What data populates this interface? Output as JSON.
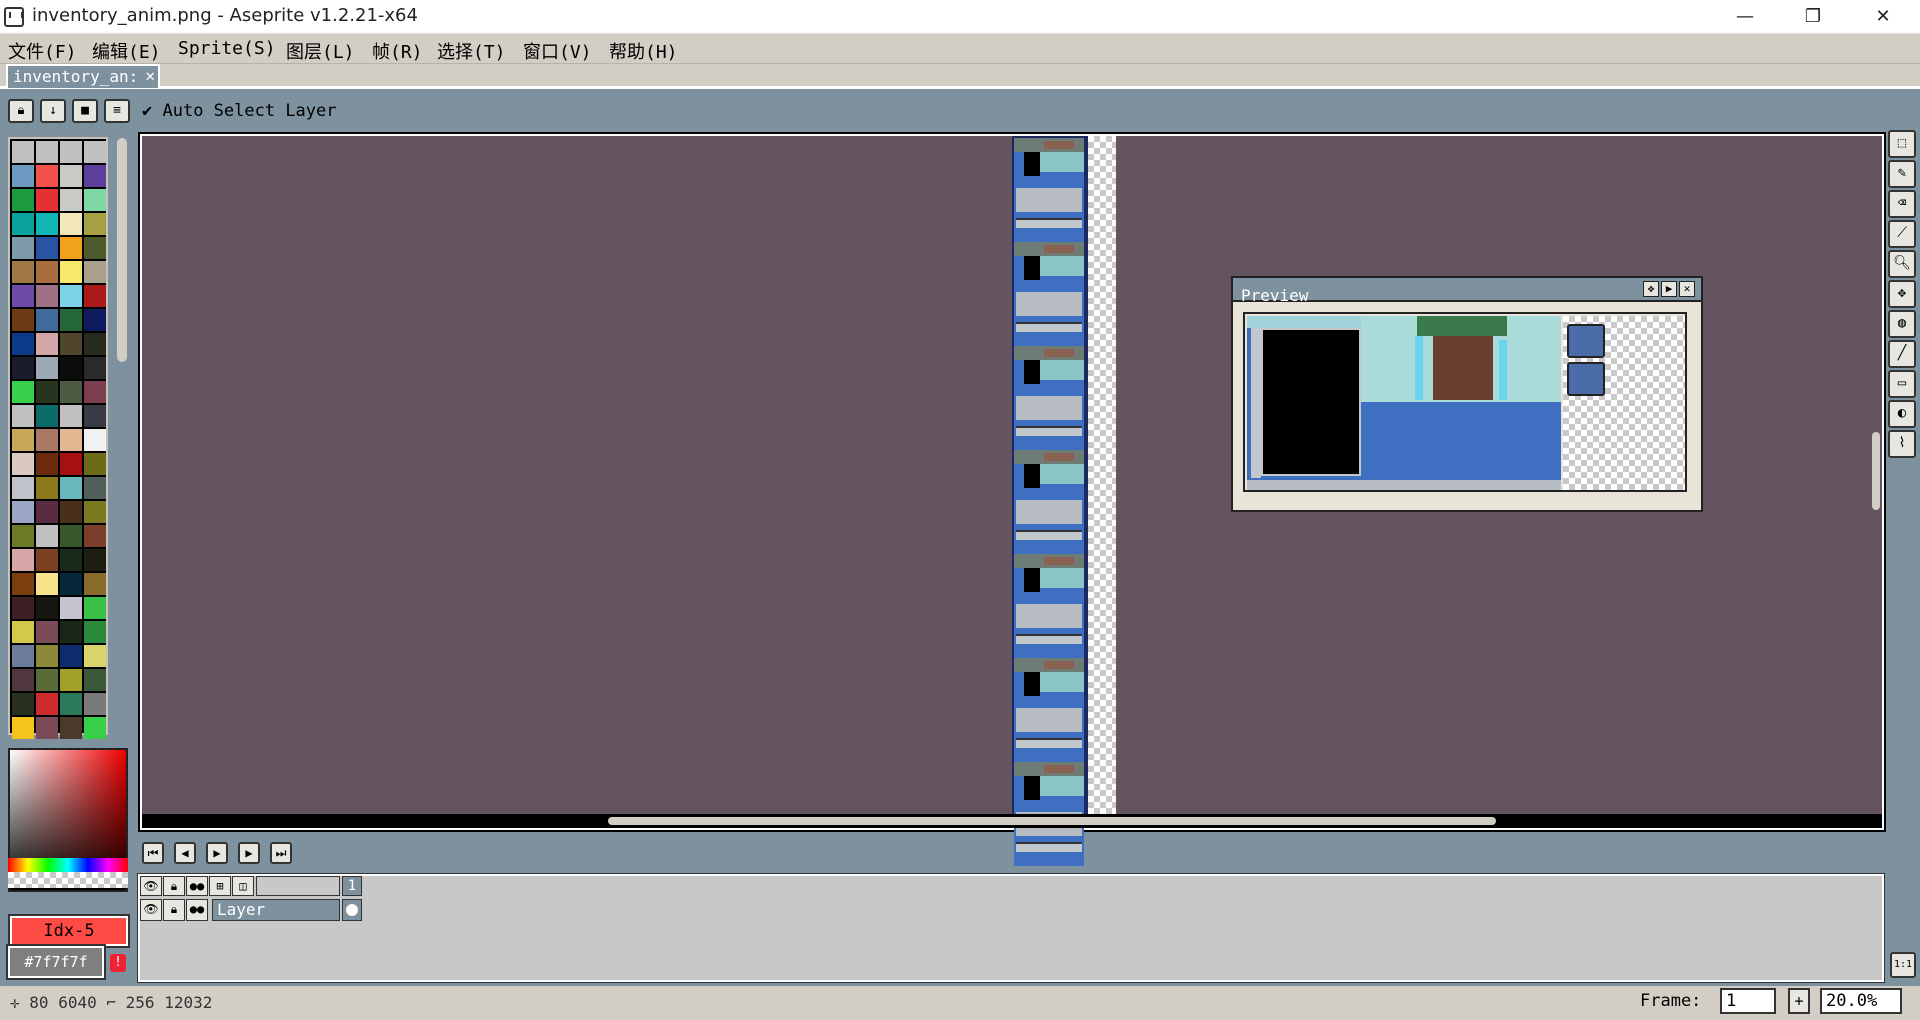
{
  "window": {
    "title": "inventory_anim.png - Aseprite v1.2.21-x64",
    "minimize": "—",
    "maximize": "❐",
    "close": "✕"
  },
  "menu": [
    "文件(F)",
    "编辑(E)",
    "Sprite(S)",
    "图层(L)",
    "帧(R)",
    "选择(T)",
    "窗口(V)",
    "帮助(H)"
  ],
  "tab": {
    "label": "inventory_an:",
    "close": "✕"
  },
  "context_bar": {
    "auto_select_label": "Auto Select Layer",
    "checkmark": "✔"
  },
  "preview": {
    "title": "Preview"
  },
  "color": {
    "index_label": "Idx-5",
    "hex_label": "#7f7f7f",
    "foreground": "#ff4b45",
    "background": "#7f7f7f",
    "warning_icon": "!"
  },
  "timeline": {
    "frame_number": "1",
    "layer_name": "Layer"
  },
  "status": {
    "pos_icon": "✛",
    "pos_x": "80",
    "pos_y": "6040",
    "size_icon": "⌐",
    "size_w": "256",
    "size_h": "12032",
    "frame_label": "Frame:",
    "frame_value": "1",
    "plus": "+",
    "zoom_value": "20.0%"
  },
  "tools": [
    "rectangular-marquee-icon",
    "pencil-icon",
    "eraser-icon",
    "eyedropper-icon",
    "zoom-icon",
    "move-icon",
    "paint-bucket-icon",
    "line-icon",
    "rectangle-icon",
    "blur-icon",
    "contour-icon"
  ],
  "palette_colors": [
    "#c0c0c0",
    "#c0c0c0",
    "#c0c0c0",
    "#c0c0c0",
    "#6d9ac0",
    "#f4504c",
    "#c9ccc5",
    "#5a3f9b",
    "#1e9b3c",
    "#e53131",
    "#c9ccc5",
    "#7dd8a3",
    "#0aa39d",
    "#12b6b4",
    "#f2e8ba",
    "#a4a043",
    "#7d9ba8",
    "#2a54a3",
    "#f2a11c",
    "#4d5a2b",
    "#a07845",
    "#aa6d3e",
    "#f6e96c",
    "#a8a08c",
    "#6d4aa8",
    "#a07086",
    "#7ed2e8",
    "#aa1a1a",
    "#6b3c13",
    "#3f6b9a",
    "#26673a",
    "#0e1a5b",
    "#0d3a89",
    "#d3a7a7",
    "#4f452a",
    "#252b1f",
    "#181c2b",
    "#9ca9b4",
    "#0a0d0a",
    "#2a2a2a",
    "#38d04a",
    "#27351f",
    "#4f5a43",
    "#7b3e4f",
    "#c0c0c0",
    "#0c6b66",
    "#c0c0c0",
    "#383b45",
    "#c9a75a",
    "#a87a63",
    "#e3b78f",
    "#f1f1f1",
    "#d9c9c0",
    "#6b2b0c",
    "#a51010",
    "#6b6b1a",
    "#bfc3c9",
    "#8c7a1a",
    "#68b8ba",
    "#4f5f5a",
    "#9aa6c3",
    "#5a2b43",
    "#4a2f1a",
    "#7a7a20",
    "#6b7a26",
    "#c0c0c0",
    "#38572a",
    "#7b3e2b",
    "#d7a6a6",
    "#7b3f22",
    "#1a2a1a",
    "#1d1d14",
    "#7a3f0c",
    "#f6e38a",
    "#07283a",
    "#866b2b",
    "#3f1f26",
    "#16160f",
    "#c4c4d0",
    "#38c048",
    "#d2c84a",
    "#7a4b56",
    "#18271a",
    "#2a8a3a",
    "#6c7c9a",
    "#8a8a3a",
    "#0c2c6b",
    "#d9d46b",
    "#50373f",
    "#5a6b3a",
    "#a3a02a",
    "#3a5a3a",
    "#27301f",
    "#ce2c2c",
    "#2a7a5a",
    "#7a7a7a",
    "#f4c41a",
    "#7a4b56",
    "#4a3a2a",
    "#38d04a"
  ]
}
